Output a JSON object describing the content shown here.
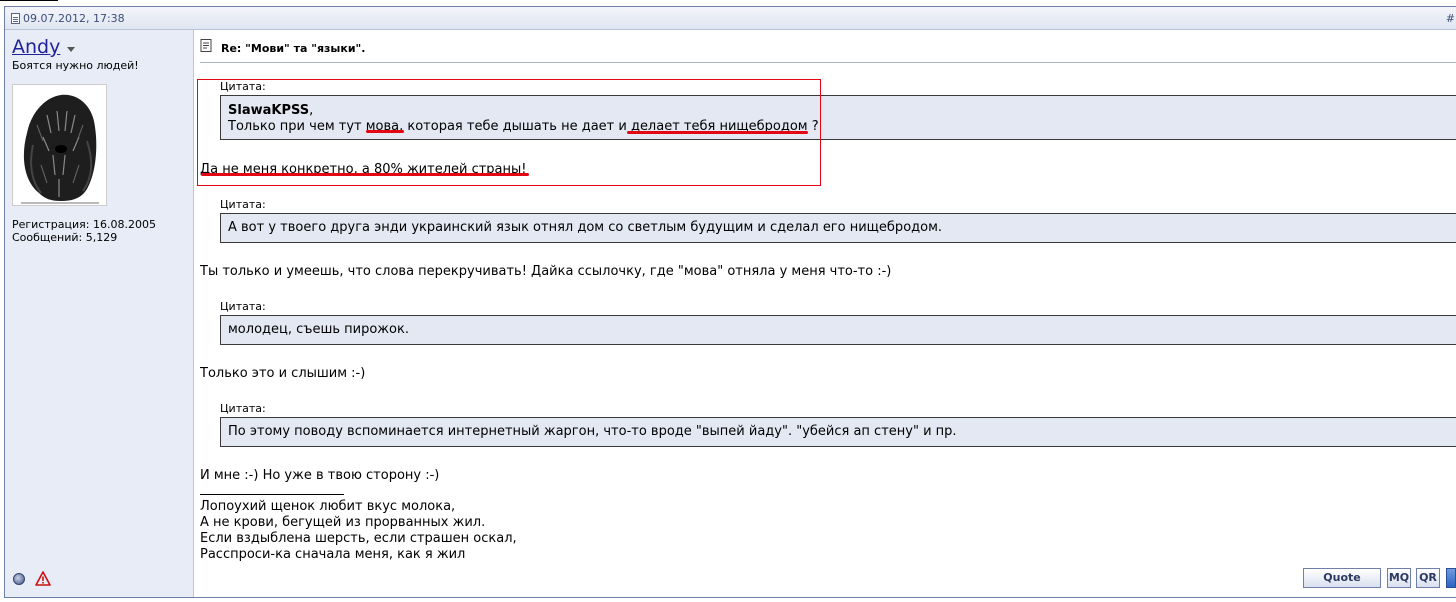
{
  "post": {
    "date": "09.07.2012, 17:38",
    "post_number": "#",
    "title": "Re: \"Мови\" та \"языки\"."
  },
  "user": {
    "name": "Andy",
    "title": "Боятся нужно людей!",
    "registration": "Регистрация: 16.08.2005",
    "posts": "Сообщений: 5,129"
  },
  "quotes": [
    {
      "label": "Цитата:",
      "author": "SlawaKPSS",
      "text": "Только при чем тут мова, которая тебе дышать не дает и делает тебя нищебродом ?"
    },
    {
      "label": "Цитата:",
      "text": "А вот у твоего друга энди украинский язык отнял дом со светлым будущим и сделал его нищебродом."
    },
    {
      "label": "Цитата:",
      "text": "молодец, съешь пирожок."
    },
    {
      "label": "Цитата:",
      "text": "По этому поводу вспоминается интернетный жаргон, что-то вроде \"выпей йаду\". \"убейся ап стену\" и пр."
    }
  ],
  "replies": [
    "Да не меня конкретно, а 80% жителей страны!",
    "Ты только и умеешь, что слова перекручивать! Дайка ссылочку, где \"мова\" отняла у меня что-то :-)",
    "Только это и слышим :-)",
    "И мне :-) Но уже в твою сторону :-)"
  ],
  "signature": [
    "Лопоухий щенок любит вкус молока,",
    "А не крови, бегущей из прорванных жил.",
    "Если вздыблена шерсть, если страшен оскал,",
    "Расспроси-ка сначала меня, как я жил"
  ],
  "buttons": {
    "quote": "Quote",
    "multiquote": "MQ",
    "quick_reply": "QR"
  },
  "icons": {
    "online": "online-status-icon",
    "report": "report-warning-icon",
    "post": "document-icon"
  },
  "colors": {
    "annotation": "#e30613",
    "quote_bg": "#e3e8f3",
    "sidebar_bg": "#e7ecf7",
    "username": "#22229c"
  }
}
